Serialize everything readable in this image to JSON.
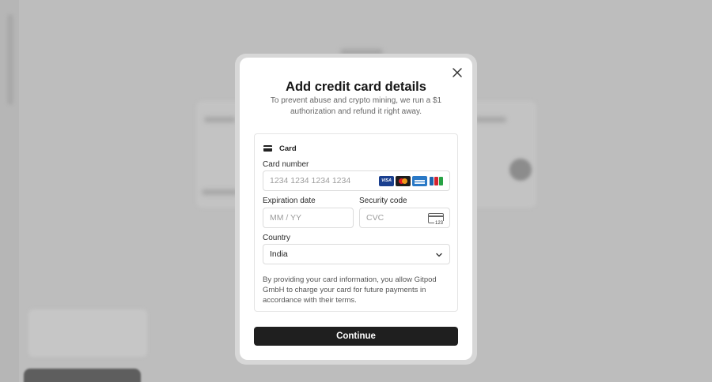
{
  "modal": {
    "title": "Add credit card details",
    "subtitle": "To prevent abuse and crypto mining, we run a $1 authorization and refund it right away.",
    "close_icon": "close-icon"
  },
  "payment": {
    "tab_label": "Card",
    "tab_icon": "credit-card-icon",
    "card_number": {
      "label": "Card number",
      "placeholder": "1234 1234 1234 1234",
      "brands": [
        "visa",
        "mastercard",
        "amex",
        "jcb"
      ]
    },
    "expiration": {
      "label": "Expiration date",
      "placeholder": "MM / YY"
    },
    "security": {
      "label": "Security code",
      "placeholder": "CVC",
      "icon": "cvc-card-icon",
      "icon_text": "123"
    },
    "country": {
      "label": "Country",
      "value": "India"
    },
    "terms": "By providing your card information, you allow Gitpod GmbH to charge your card for future payments in accordance with their terms."
  },
  "actions": {
    "continue_label": "Continue"
  },
  "colors": {
    "overlay": "#bdbdbd",
    "button": "#1f1f1f",
    "visa": "#1a3f8f",
    "mastercard_red": "#e81d23",
    "mastercard_orange": "#f7a21b",
    "amex": "#2a79c6"
  }
}
